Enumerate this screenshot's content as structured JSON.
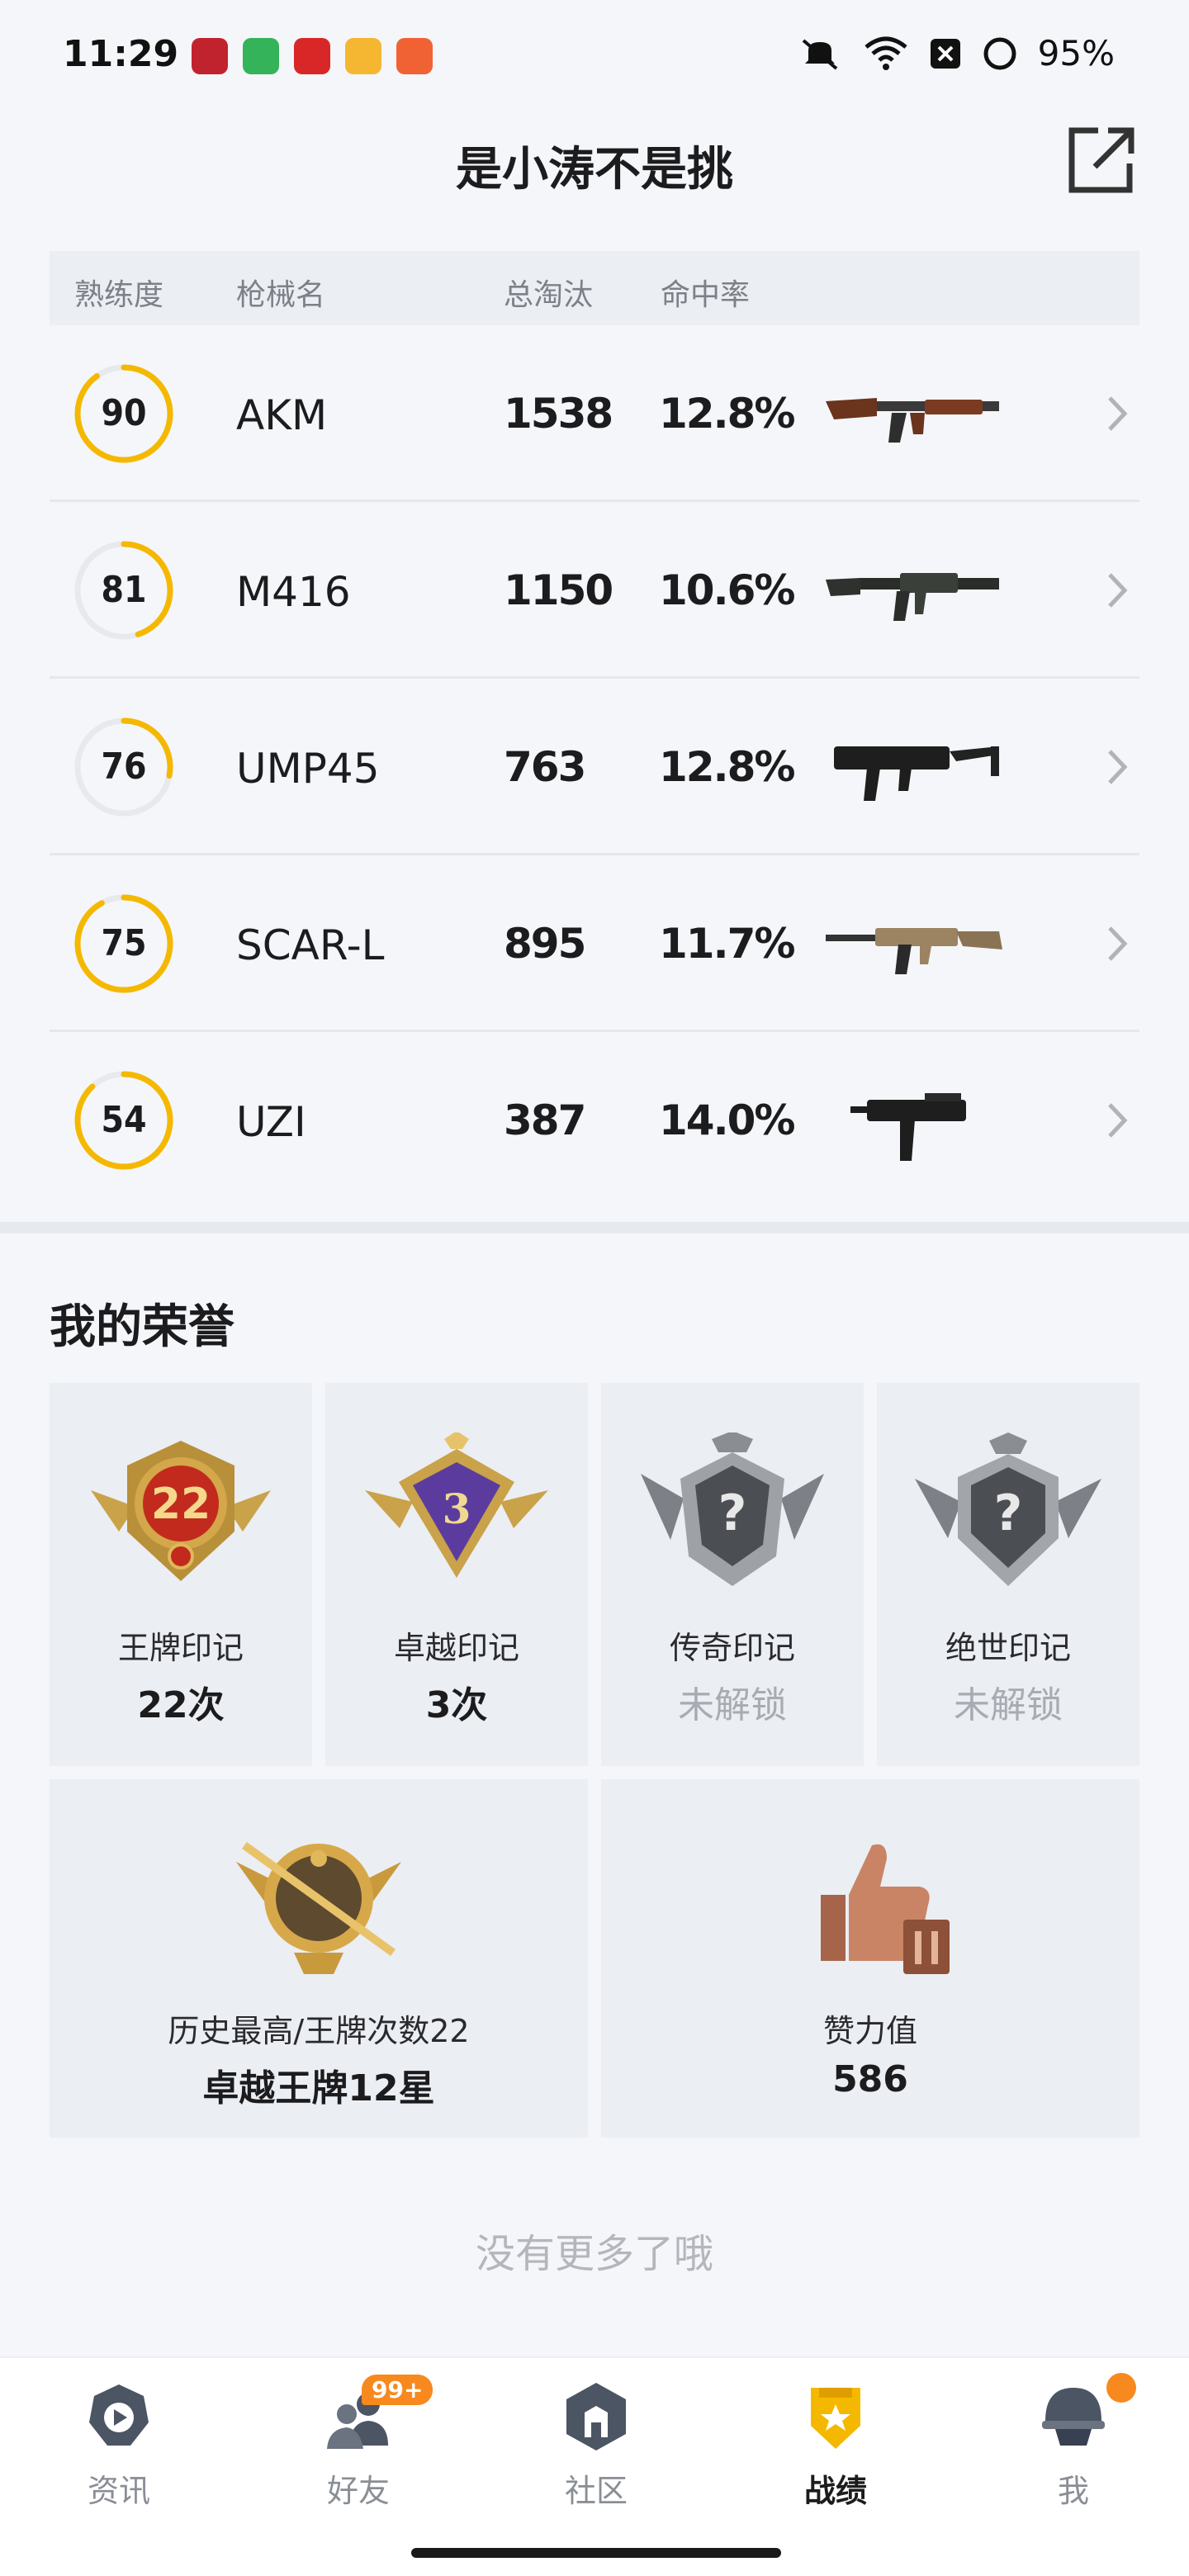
{
  "status_bar": {
    "time": "11:29",
    "battery": "95%",
    "app_icons": [
      {
        "name": "app-red-icon",
        "color": "#c0232e"
      },
      {
        "name": "app-shield-icon",
        "color": "#34b35a"
      },
      {
        "name": "app-book-icon",
        "color": "#d92727"
      },
      {
        "name": "app-note-icon",
        "color": "#f5b731"
      },
      {
        "name": "app-mail-icon",
        "color": "#f06234"
      }
    ]
  },
  "header": {
    "title": "是小涛不是挑"
  },
  "table": {
    "headers": [
      "熟练度",
      "枪械名",
      "总淘汰",
      "命中率"
    ],
    "rows": [
      {
        "mastery": "90",
        "mastery_pct": 0.9,
        "name": "AKM",
        "kills": "1538",
        "accuracy": "12.8%",
        "icon": "akm-rifle-icon"
      },
      {
        "mastery": "81",
        "mastery_pct": 0.45,
        "name": "M416",
        "kills": "1150",
        "accuracy": "10.6%",
        "icon": "m416-rifle-icon"
      },
      {
        "mastery": "76",
        "mastery_pct": 0.28,
        "name": "UMP45",
        "kills": "763",
        "accuracy": "12.8%",
        "icon": "ump45-smg-icon"
      },
      {
        "mastery": "75",
        "mastery_pct": 0.92,
        "name": "SCAR-L",
        "kills": "895",
        "accuracy": "11.7%",
        "icon": "scarl-rifle-icon"
      },
      {
        "mastery": "54",
        "mastery_pct": 0.88,
        "name": "UZI",
        "kills": "387",
        "accuracy": "14.0%",
        "icon": "uzi-smg-icon"
      }
    ]
  },
  "honor": {
    "title": "我的荣誉",
    "badges": [
      {
        "label": "王牌印记",
        "value": "22次",
        "locked": false,
        "icon": "ace-badge-icon",
        "number": "22"
      },
      {
        "label": "卓越印记",
        "value": "3次",
        "locked": false,
        "icon": "excellence-badge-icon",
        "number": "3"
      },
      {
        "label": "传奇印记",
        "value": "未解锁",
        "locked": true,
        "icon": "legend-badge-locked-icon",
        "number": "?"
      },
      {
        "label": "绝世印记",
        "value": "未解锁",
        "locked": true,
        "icon": "peerless-badge-locked-icon",
        "number": "?"
      }
    ],
    "best_rank": {
      "label": "历史最高/王牌次数22",
      "value": "卓越王牌12星"
    },
    "likes": {
      "label": "赞力值",
      "value": "586"
    }
  },
  "footer_note": "没有更多了哦",
  "nav": [
    {
      "label": "资讯",
      "icon": "news-icon",
      "active": false
    },
    {
      "label": "好友",
      "icon": "friends-icon",
      "active": false,
      "badge": "99+"
    },
    {
      "label": "社区",
      "icon": "community-icon",
      "active": false
    },
    {
      "label": "战绩",
      "icon": "stats-icon",
      "active": true
    },
    {
      "label": "我",
      "icon": "profile-icon",
      "active": false
    }
  ],
  "colors": {
    "accent": "#f5b800",
    "ring_track": "#e8e9ec",
    "badge_orange": "#f7891e"
  }
}
